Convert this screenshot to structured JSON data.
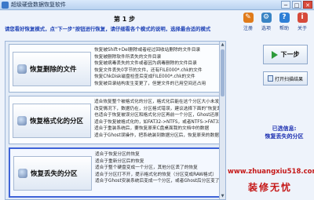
{
  "window": {
    "title": "超级硬盘数据恢复软件",
    "buttons": [
      "─",
      "□",
      "✕"
    ]
  },
  "header": {
    "step": "第 1 步",
    "instruction": "请您看好恢复模式，点\"下一步\"按钮进行恢复，请仔细看各个模式的说明，选择最合适的模式"
  },
  "toolbar": [
    {
      "label": "注册",
      "icon": "register-icon",
      "color": "#e07b1a",
      "glyph": "✎"
    },
    {
      "label": "选项",
      "icon": "options-icon",
      "color": "#3a84c4",
      "glyph": "⚙"
    },
    {
      "label": "帮助",
      "icon": "help-icon",
      "color": "#2f7fd6",
      "glyph": "?"
    },
    {
      "label": "关于",
      "icon": "about-icon",
      "color": "#d64a3a",
      "glyph": "i"
    }
  ],
  "options": [
    {
      "label": "恢复删除的文件",
      "selected": false,
      "desc": [
        "恢复被Shift+Del删除或者经过回收站删除的文件目录",
        "恢复被删除软件所丢失的文件目录",
        "恢复被病毒丢失的文件或者因为病毒删除的文件目录",
        "恢复文件丢失0字节的文件，还有FILE000*.chk的文件",
        "恢复ChkDisk磁盘检查后变成FILE000*.chk的文件",
        "恢复被目录结构发生变更了，但是文件的已用空间还占用"
      ]
    },
    {
      "label": "恢复格式化的分区",
      "selected": false,
      "desc": [
        "适合恢复整个被格式化的分区，格式化后能在这个分区大小未发生",
        "改变情况下，数据仍在，分区格式错误，建议选择下面的\"恢复丢失的分区\"",
        "也适合于恢复被误分区和格式化分区再前一个分区，Ghost还原",
        "适合于恢复被格式化的，如FAT32->NTFS，或者NTFS->FAT32",
        "适合于重装系统后，要恢复原来C盘桌面我的文档中的数据",
        "适合于Ghost误操作，把系统装到数据分区后，恢复原来的数据"
      ]
    },
    {
      "label": "恢复丢失的分区",
      "selected": true,
      "desc": [
        "适合于恢复分区的恢复",
        "适合于重新分区后的恢复",
        "适合于整个硬盘变成一个分区，其他分区丢了的恢复",
        "适合于分区打不开，提示格式化的恢复（分区变成RAW格式）",
        "适合于Ghost安装系统后变成一个分区，或者Ghost后分区变了的恢复"
      ]
    }
  ],
  "actions": {
    "next": "下一步",
    "open_scan": "打开扫描结果"
  },
  "info": {
    "label": "已选信息:",
    "value": "恢复丢失的分区"
  },
  "watermark": {
    "site": "www.zhuangxiu518.com",
    "brand": "装修无忧"
  }
}
